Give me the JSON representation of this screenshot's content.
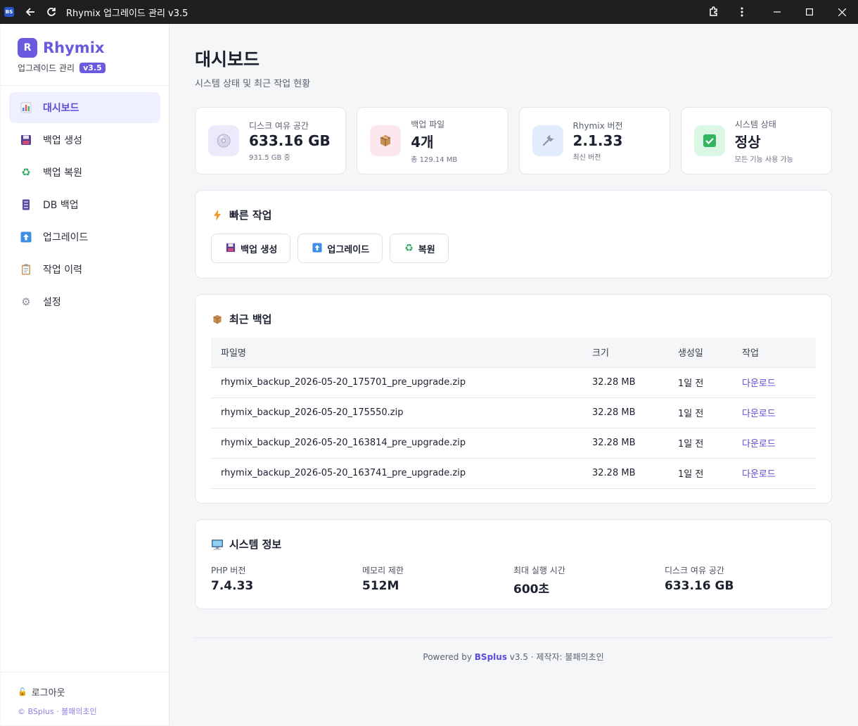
{
  "window": {
    "title": "Rhymix 업그레이드 관리 v3.5",
    "app_icon": "BS"
  },
  "sidebar": {
    "logo_letter": "R",
    "brand": "Rhymix",
    "subtitle": "업그레이드 관리",
    "version": "v3.5",
    "items": [
      {
        "label": "대시보드",
        "icon": "bar-chart-icon",
        "active": true
      },
      {
        "label": "백업 생성",
        "icon": "floppy-disk-icon"
      },
      {
        "label": "백업 복원",
        "icon": "recycle-icon"
      },
      {
        "label": "DB 백업",
        "icon": "database-icon"
      },
      {
        "label": "업그레이드",
        "icon": "up-arrow-icon"
      },
      {
        "label": "작업 이력",
        "icon": "clipboard-icon"
      },
      {
        "label": "설정",
        "icon": "gear-icon"
      }
    ],
    "logout": "로그아웃",
    "copyright": "© BSplus · 불패의초인"
  },
  "main": {
    "title": "대시보드",
    "subtitle": "시스템 상태 및 최근 작업 현황",
    "stats": [
      {
        "label": "디스크 여유 공간",
        "value": "633.16 GB",
        "note": "931.5 GB 중",
        "icon": "disc-icon",
        "bg": "#ede9fb"
      },
      {
        "label": "백업 파일",
        "value": "4개",
        "note": "총 129.14 MB",
        "icon": "package-icon",
        "bg": "#fde7ef"
      },
      {
        "label": "Rhymix 버전",
        "value": "2.1.33",
        "note": "최신 버전",
        "icon": "wrench-icon",
        "bg": "#e2ecfd"
      },
      {
        "label": "시스템 상태",
        "value": "정상",
        "note": "모든 기능 사용 가능",
        "icon": "check-icon",
        "bg": "#dcf6e6"
      }
    ],
    "quick_actions": {
      "title": "빠른 작업",
      "buttons": [
        {
          "label": "백업 생성",
          "icon": "floppy-disk-icon"
        },
        {
          "label": "업그레이드",
          "icon": "up-arrow-icon"
        },
        {
          "label": "복원",
          "icon": "recycle-icon"
        }
      ]
    },
    "recent": {
      "title": "최근 백업",
      "headers": [
        "파일명",
        "크기",
        "생성일",
        "작업"
      ],
      "rows": [
        {
          "file": "rhymix_backup_2026-05-20_175701_pre_upgrade.zip",
          "size": "32.28 MB",
          "date": "1일 전",
          "action": "다운로드"
        },
        {
          "file": "rhymix_backup_2026-05-20_175550.zip",
          "size": "32.28 MB",
          "date": "1일 전",
          "action": "다운로드"
        },
        {
          "file": "rhymix_backup_2026-05-20_163814_pre_upgrade.zip",
          "size": "32.28 MB",
          "date": "1일 전",
          "action": "다운로드"
        },
        {
          "file": "rhymix_backup_2026-05-20_163741_pre_upgrade.zip",
          "size": "32.28 MB",
          "date": "1일 전",
          "action": "다운로드"
        }
      ]
    },
    "system": {
      "title": "시스템 정보",
      "items": [
        {
          "label": "PHP 버전",
          "value": "7.4.33"
        },
        {
          "label": "메모리 제한",
          "value": "512M"
        },
        {
          "label": "최대 실행 시간",
          "value": "600초"
        },
        {
          "label": "디스크 여유 공간",
          "value": "633.16 GB"
        }
      ]
    },
    "footer": {
      "prefix": "Powered by",
      "brand": "BSplus",
      "suffix": "v3.5 · 제작자: 불패의초인"
    }
  }
}
